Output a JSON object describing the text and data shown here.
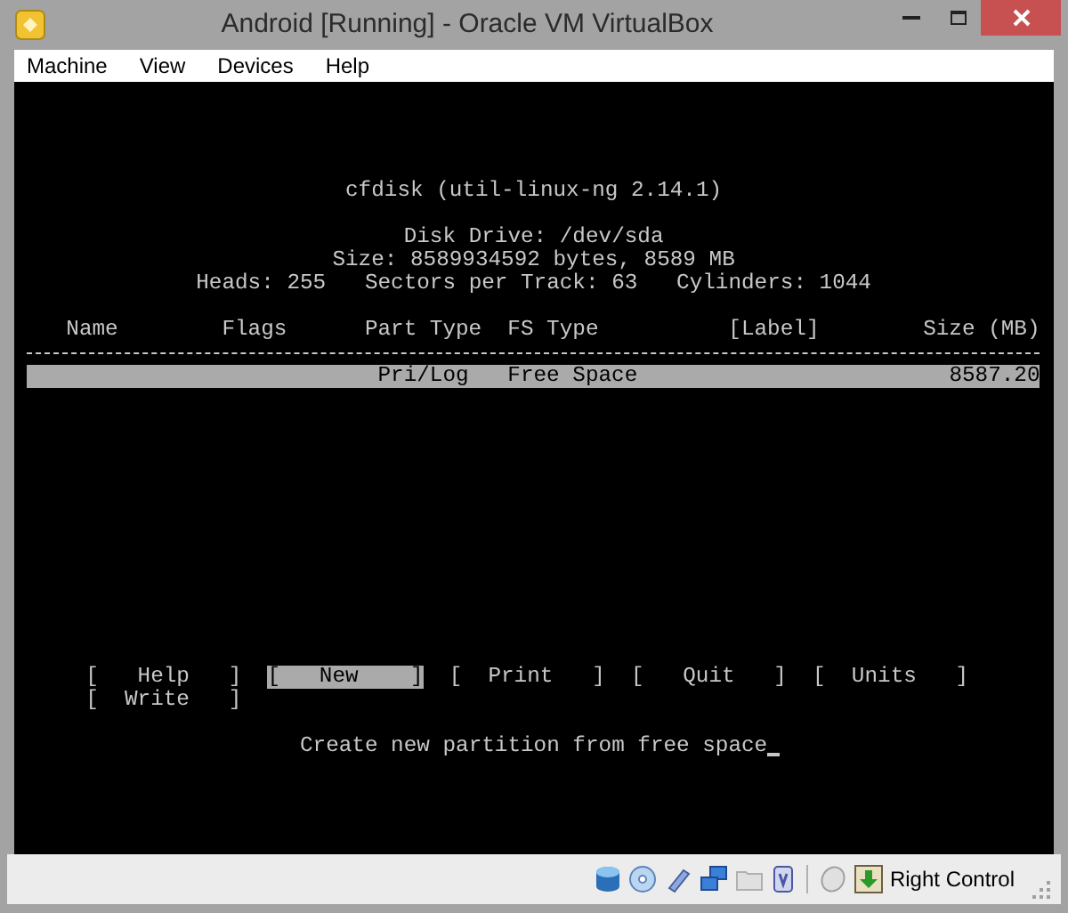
{
  "window": {
    "title": "Android [Running] - Oracle VM VirtualBox"
  },
  "menu": [
    "Machine",
    "View",
    "Devices",
    "Help"
  ],
  "console": {
    "title": "cfdisk (util-linux-ng 2.14.1)",
    "disk_info": [
      "Disk Drive: /dev/sda",
      "Size: 8589934592 bytes, 8589 MB",
      "Heads: 255   Sectors per Track: 63   Cylinders: 1044"
    ],
    "columns": [
      "Name",
      "Flags",
      "Part Type",
      "FS Type",
      "[Label]",
      "Size (MB)"
    ],
    "rows": [
      {
        "part_type": "Pri/Log",
        "fs_type": "Free Space",
        "size": "8587.20",
        "selected": true
      }
    ],
    "commands": [
      {
        "text": "[   Help   ]",
        "selected": false
      },
      {
        "text": "[   New    ]",
        "selected": true
      },
      {
        "text": "[  Print   ]",
        "selected": false
      },
      {
        "text": "[   Quit   ]",
        "selected": false
      },
      {
        "text": "[  Units   ]",
        "selected": false
      },
      {
        "text": "[  Write   ]",
        "selected": false
      }
    ],
    "message": "Create new partition from free space"
  },
  "status_bar": {
    "host_key": "Right Control"
  }
}
